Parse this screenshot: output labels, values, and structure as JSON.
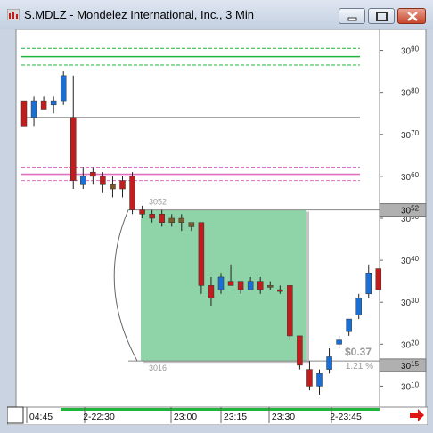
{
  "window": {
    "title": "S.MDLZ - Mondelez International, Inc., 3 Min",
    "buttons": [
      "minimize",
      "maximize",
      "close"
    ]
  },
  "colors": {
    "up_candle": "#1a6fd6",
    "down_candle": "#c21d1d",
    "neutral_candle": "#7a5c2a",
    "zone_fill": "#8fd3a8",
    "green_line": "#1fb43a",
    "pink_line": "#e070c0",
    "gray_line": "#9a9a9a",
    "price_marker_bg": "#b0b0b0"
  },
  "chart_data": {
    "type": "candlestick",
    "ylim": [
      30.05,
      30.95
    ],
    "y_ticks": [
      {
        "value": 30.1,
        "label": "3010"
      },
      {
        "value": 30.2,
        "label": "3020"
      },
      {
        "value": 30.3,
        "label": "3030"
      },
      {
        "value": 30.4,
        "label": "3040"
      },
      {
        "value": 30.5,
        "label": "3050"
      },
      {
        "value": 30.6,
        "label": "3060"
      },
      {
        "value": 30.7,
        "label": "3070"
      },
      {
        "value": 30.8,
        "label": "3080"
      },
      {
        "value": 30.9,
        "label": "3090"
      }
    ],
    "x_ticks": [
      "04:45",
      "2-22:30",
      "23:00",
      "23:15",
      "23:30",
      "2-23:45"
    ],
    "candles": [
      {
        "o": 30.72,
        "h": 30.77,
        "l": 30.75,
        "c": 30.78,
        "color": "down"
      },
      {
        "o": 30.74,
        "h": 30.79,
        "l": 30.72,
        "c": 30.78,
        "color": "up"
      },
      {
        "o": 30.78,
        "h": 30.79,
        "l": 30.76,
        "c": 30.76,
        "color": "down"
      },
      {
        "o": 30.77,
        "h": 30.79,
        "l": 30.75,
        "c": 30.78,
        "color": "up"
      },
      {
        "o": 30.78,
        "h": 30.85,
        "l": 30.77,
        "c": 30.84,
        "color": "up"
      },
      {
        "o": 30.74,
        "h": 30.84,
        "l": 30.57,
        "c": 30.59,
        "color": "down"
      },
      {
        "o": 30.58,
        "h": 30.62,
        "l": 30.57,
        "c": 30.6,
        "color": "up"
      },
      {
        "o": 30.61,
        "h": 30.62,
        "l": 30.58,
        "c": 30.6,
        "color": "down"
      },
      {
        "o": 30.6,
        "h": 30.61,
        "l": 30.56,
        "c": 30.58,
        "color": "down"
      },
      {
        "o": 30.58,
        "h": 30.6,
        "l": 30.55,
        "c": 30.57,
        "color": "neutral"
      },
      {
        "o": 30.59,
        "h": 30.6,
        "l": 30.55,
        "c": 30.57,
        "color": "down"
      },
      {
        "o": 30.6,
        "h": 30.61,
        "l": 30.51,
        "c": 30.52,
        "color": "down"
      },
      {
        "o": 30.52,
        "h": 30.53,
        "l": 30.5,
        "c": 30.51,
        "color": "down"
      },
      {
        "o": 30.51,
        "h": 30.52,
        "l": 30.49,
        "c": 30.5,
        "color": "down"
      },
      {
        "o": 30.51,
        "h": 30.52,
        "l": 30.48,
        "c": 30.49,
        "color": "down"
      },
      {
        "o": 30.49,
        "h": 30.51,
        "l": 30.48,
        "c": 30.5,
        "color": "neutral"
      },
      {
        "o": 30.5,
        "h": 30.51,
        "l": 30.47,
        "c": 30.49,
        "color": "neutral"
      },
      {
        "o": 30.49,
        "h": 30.49,
        "l": 30.47,
        "c": 30.48,
        "color": "neutral"
      },
      {
        "o": 30.49,
        "h": 30.49,
        "l": 30.32,
        "c": 30.34,
        "color": "down"
      },
      {
        "o": 30.34,
        "h": 30.36,
        "l": 30.29,
        "c": 30.31,
        "color": "down"
      },
      {
        "o": 30.33,
        "h": 30.37,
        "l": 30.32,
        "c": 30.36,
        "color": "up"
      },
      {
        "o": 30.35,
        "h": 30.39,
        "l": 30.34,
        "c": 30.34,
        "color": "down"
      },
      {
        "o": 30.35,
        "h": 30.35,
        "l": 30.32,
        "c": 30.33,
        "color": "down"
      },
      {
        "o": 30.33,
        "h": 30.36,
        "l": 30.33,
        "c": 30.35,
        "color": "up"
      },
      {
        "o": 30.35,
        "h": 30.36,
        "l": 30.32,
        "c": 30.33,
        "color": "down"
      },
      {
        "o": 30.34,
        "h": 30.35,
        "l": 30.33,
        "c": 30.34,
        "color": "neutral"
      },
      {
        "o": 30.33,
        "h": 30.34,
        "l": 30.32,
        "c": 30.33,
        "color": "down"
      },
      {
        "o": 30.34,
        "h": 30.34,
        "l": 30.21,
        "c": 30.22,
        "color": "down"
      },
      {
        "o": 30.22,
        "h": 30.22,
        "l": 30.14,
        "c": 30.15,
        "color": "down"
      },
      {
        "o": 30.14,
        "h": 30.16,
        "l": 30.09,
        "c": 30.1,
        "color": "down"
      },
      {
        "o": 30.1,
        "h": 30.14,
        "l": 30.08,
        "c": 30.13,
        "color": "up"
      },
      {
        "o": 30.14,
        "h": 30.19,
        "l": 30.13,
        "c": 30.17,
        "color": "up"
      },
      {
        "o": 30.2,
        "h": 30.22,
        "l": 30.19,
        "c": 30.21,
        "color": "up"
      },
      {
        "o": 30.23,
        "h": 30.26,
        "l": 30.22,
        "c": 30.26,
        "color": "up"
      },
      {
        "o": 30.27,
        "h": 30.32,
        "l": 30.26,
        "c": 30.31,
        "color": "up"
      },
      {
        "o": 30.32,
        "h": 30.39,
        "l": 30.31,
        "c": 30.37,
        "color": "up"
      },
      {
        "o": 30.38,
        "h": 30.38,
        "l": 30.33,
        "c": 30.33,
        "color": "down"
      }
    ],
    "h_lines": [
      {
        "value": 30.905,
        "style": "dashed",
        "color": "green_line"
      },
      {
        "value": 30.885,
        "style": "solid",
        "color": "green_line"
      },
      {
        "value": 30.865,
        "style": "dashed",
        "color": "green_line"
      },
      {
        "value": 30.74,
        "style": "solid",
        "color": "gray_line"
      },
      {
        "value": 30.62,
        "style": "dashed",
        "color": "pink_line"
      },
      {
        "value": 30.605,
        "style": "solid",
        "color": "pink_line"
      },
      {
        "value": 30.59,
        "style": "dashed",
        "color": "pink_line"
      }
    ],
    "zone": {
      "top": 30.52,
      "bottom": 30.16
    },
    "labels": {
      "zone_top": "3052",
      "zone_bottom": "3016",
      "change_value": "$0.37",
      "change_pct": "1.21 %"
    },
    "price_markers": [
      {
        "value": 30.52,
        "label": "3052"
      },
      {
        "value": 30.15,
        "label": "3015"
      }
    ]
  }
}
